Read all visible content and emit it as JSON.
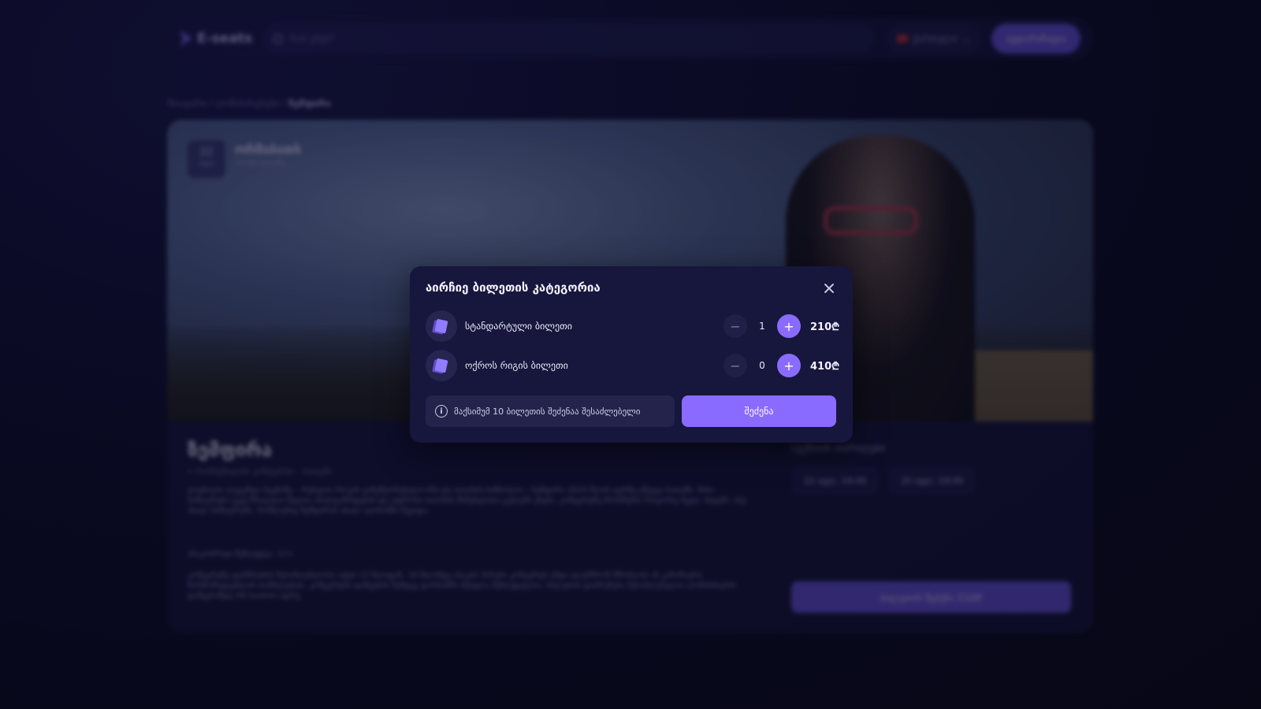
{
  "header": {
    "logo_text": "E-seats",
    "search_placeholder": "რას ეძებ?",
    "language": "ქართული",
    "auth_button": "ავტორიზაცია"
  },
  "breadcrumb": {
    "items": [
      "მთავარი",
      "ღონისძიებები"
    ],
    "current": "ზემფირა"
  },
  "event": {
    "date_day": "22",
    "date_month": "ივლ",
    "weekday": "ორშაბათს",
    "time": "19:00 საათზე",
    "title": "ზემფირა",
    "venue": "რომპეჩილის კონტურბი - ბათუმი",
    "description": "ცოცხალი ლეგენდა სცენაზე – რუსული როკის განუმეორებელი ხმა და თაობის სიმბოლო – ზემფირა 2025 წლის ტურზე ეწვევა ბათუმს. მისი სიმღერები უკვე მრავალი წელია ახალგაზრდების და უფროსი თაობის მსმენელთა გულებს ეხება. კონცერტზე მოისმენთ როგორც ძველ ჰიტებს, ისე ახალ სიმღერებს, რომლებიც ზემფირას ახალ ალბომში შევიდა.",
    "age_limit": "ასაკობრივი შეზღუდვა: 12+",
    "notice": "კონცერტზე დასწრების შესაძლებლობა აქვთ 12 წლიდან. 18 წლამდე ასაკის პირები კონცერტს უნდა დაესწრონ მშობლის ან კანონიერი წარმომადგენლის თანხლებით. კონცერტის დაწყების შემდეგ დარბაზში შესვლა შეზღუდულია. ბილეთის დაბრუნება შესაძლებელია ღონისძიების დაწყებამდე 48 საათით ადრე.",
    "dates_title": "ივენთის თარიღები",
    "dates": [
      "22 ივლ, 19:00",
      "25 ივლ, 19:00"
    ],
    "buy_label": "ბილეთის შეძენა 210₾"
  },
  "modal": {
    "title": "აირჩიე ბილეთის კატეგორია",
    "tickets": [
      {
        "name": "სტანდარტული ბილეთი",
        "quantity": "1",
        "price": "210₾",
        "minus": "−",
        "plus": "+"
      },
      {
        "name": "ოქროს რიგის ბილეთი",
        "quantity": "0",
        "price": "410₾",
        "minus": "−",
        "plus": "+"
      }
    ],
    "info_text": "მაქსიმუმ 10 ბილეთის შეძენაა შესაძლებელი",
    "info_symbol": "i",
    "buy_button": "შეძენა"
  },
  "colors": {
    "accent": "#8a6bff",
    "modal_bg": "#17163c",
    "page_bg": "#0a0a24"
  }
}
